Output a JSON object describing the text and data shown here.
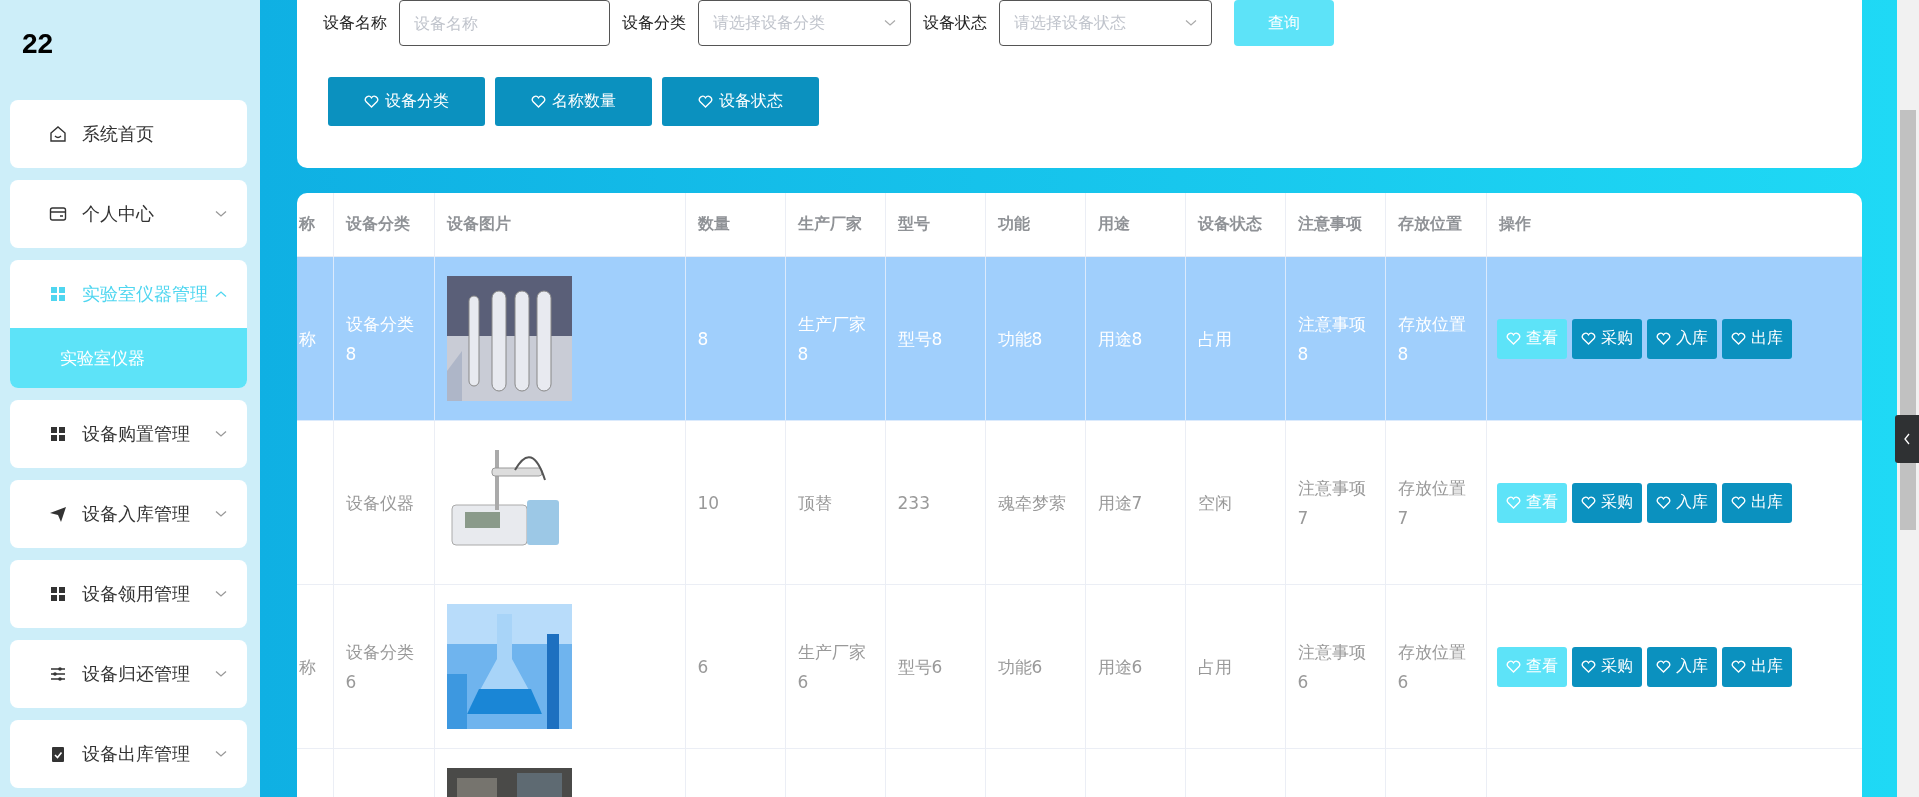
{
  "sidebar": {
    "logo": "22",
    "items": [
      {
        "label": "系统首页"
      },
      {
        "label": "个人中心",
        "expanded": false
      },
      {
        "label": "实验室仪器管理",
        "expanded": true,
        "children": [
          {
            "label": "实验室仪器",
            "selected": true
          }
        ]
      },
      {
        "label": "设备购置管理",
        "expanded": false
      },
      {
        "label": "设备入库管理",
        "expanded": false
      },
      {
        "label": "设备领用管理",
        "expanded": false
      },
      {
        "label": "设备归还管理",
        "expanded": false
      },
      {
        "label": "设备出库管理",
        "expanded": false
      }
    ]
  },
  "filters": [
    {
      "kind": "text",
      "label": "设备名称",
      "placeholder": "设备名称"
    },
    {
      "kind": "select",
      "label": "设备分类",
      "placeholder": "请选择设备分类"
    },
    {
      "kind": "select",
      "label": "设备状态",
      "placeholder": "请选择设备状态"
    }
  ],
  "query_button": "查询",
  "chart_buttons": [
    "设备分类",
    "名称数量",
    "设备状态"
  ],
  "table": {
    "columns": [
      "称",
      "设备分类",
      "设备图片",
      "数量",
      "生产厂家",
      "型号",
      "功能",
      "用途",
      "设备状态",
      "注意事项",
      "存放位置",
      "操作"
    ],
    "rows": [
      {
        "selected": true,
        "cells": [
          "称",
          "设备分类8",
          {
            "kind": "picture"
          },
          "8",
          "生产厂家8",
          "型号8",
          "功能8",
          "用途8",
          "占用",
          "注意事项8",
          "存放位置8"
        ],
        "actions": [
          {
            "kind": "light",
            "label": "查看"
          },
          {
            "kind": "dark",
            "label": "采购"
          },
          {
            "kind": "dark",
            "label": "入库"
          },
          {
            "kind": "dark",
            "label": "出库"
          }
        ]
      },
      {
        "selected": false,
        "cells": [
          "",
          "设备仪器",
          {
            "kind": "picture"
          },
          "10",
          "顶替",
          "233",
          "魂牵梦萦",
          "用途7",
          "空闲",
          "注意事项7",
          "存放位置7"
        ],
        "actions": [
          {
            "kind": "light",
            "label": "查看"
          },
          {
            "kind": "dark",
            "label": "采购"
          },
          {
            "kind": "dark",
            "label": "入库"
          },
          {
            "kind": "dark",
            "label": "出库"
          }
        ]
      },
      {
        "selected": false,
        "cells": [
          "称",
          "设备分类6",
          {
            "kind": "picture"
          },
          "6",
          "生产厂家6",
          "型号6",
          "功能6",
          "用途6",
          "占用",
          "注意事项6",
          "存放位置6"
        ],
        "actions": [
          {
            "kind": "light",
            "label": "查看"
          },
          {
            "kind": "dark",
            "label": "采购"
          },
          {
            "kind": "dark",
            "label": "入库"
          },
          {
            "kind": "dark",
            "label": "出库"
          }
        ]
      },
      {
        "selected": false,
        "cells": [
          "",
          "",
          {
            "kind": "picture"
          },
          "",
          "",
          "",
          "",
          "",
          "",
          "",
          ""
        ],
        "actions": []
      }
    ]
  }
}
